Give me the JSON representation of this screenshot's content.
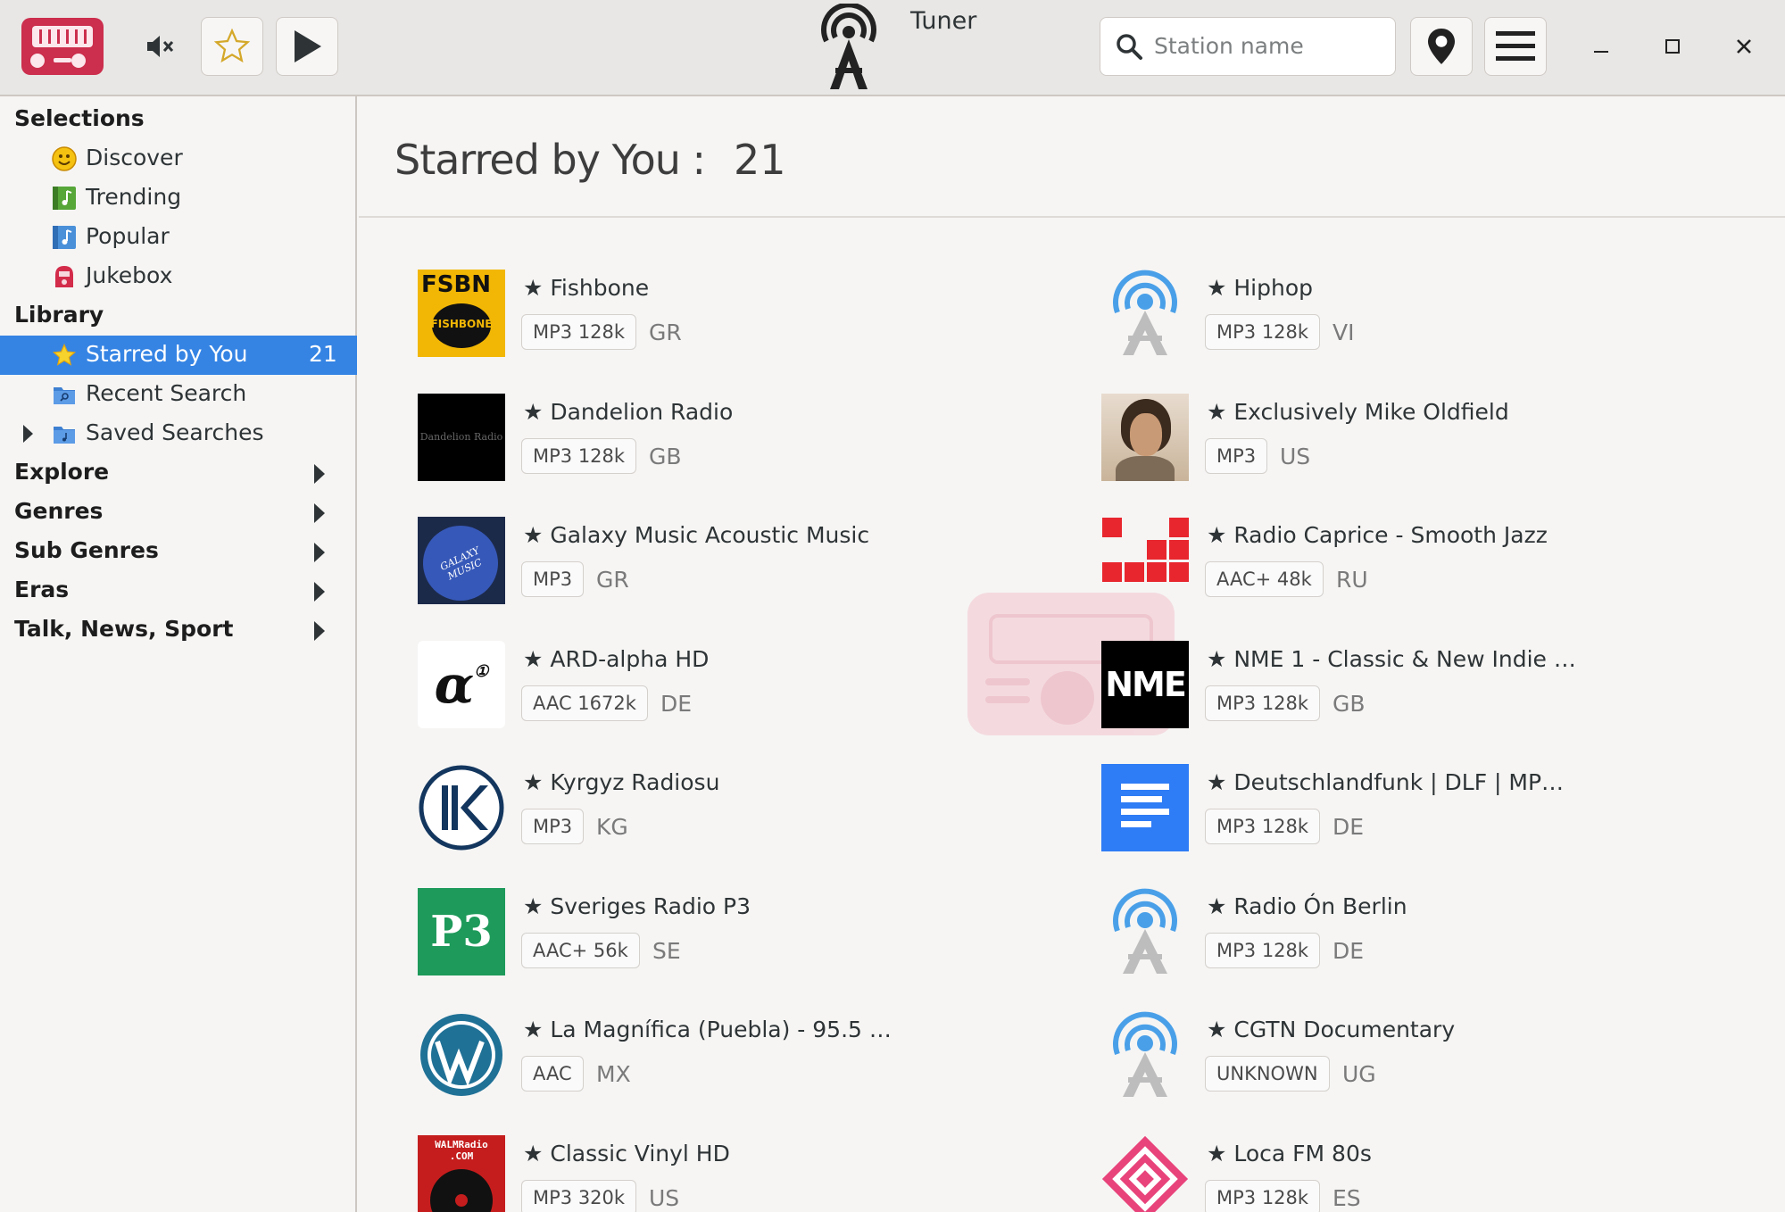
{
  "header": {
    "title": "Tuner",
    "search_placeholder": "Station name"
  },
  "sidebar": {
    "selections_label": "Selections",
    "library_label": "Library",
    "selections": [
      {
        "label": "Discover",
        "icon": "smiley-icon"
      },
      {
        "label": "Trending",
        "icon": "music-green-icon"
      },
      {
        "label": "Popular",
        "icon": "music-blue-icon"
      },
      {
        "label": "Jukebox",
        "icon": "jukebox-icon"
      }
    ],
    "library": [
      {
        "label": "Starred by You",
        "count": "21",
        "icon": "star-icon"
      },
      {
        "label": "Recent Search",
        "icon": "folder-search-icon"
      },
      {
        "label": "Saved Searches",
        "icon": "folder-music-icon"
      }
    ],
    "categories": [
      "Explore",
      "Genres",
      "Sub Genres",
      "Eras",
      "Talk, News, Sport"
    ]
  },
  "main": {
    "heading": "Starred by You :",
    "count": "21"
  },
  "stations": [
    {
      "name": "★ Fishbone",
      "tag": "MP3 128k",
      "country": "GR",
      "logo": "fishbone"
    },
    {
      "name": "★ Hiphop",
      "tag": "MP3 128k",
      "country": "VI",
      "logo": "default"
    },
    {
      "name": "★ Dandelion Radio",
      "tag": "MP3 128k",
      "country": "GB",
      "logo": "dandelion"
    },
    {
      "name": "★ Exclusively Mike Oldfield",
      "tag": "MP3",
      "country": "US",
      "logo": "photo"
    },
    {
      "name": "★ Galaxy Music Acoustic Music",
      "tag": "MP3",
      "country": "GR",
      "logo": "galaxy"
    },
    {
      "name": "★ Radio Caprice - Smooth Jazz",
      "tag": "AAC+ 48k",
      "country": "RU",
      "logo": "caprice"
    },
    {
      "name": "★ ARD-alpha HD",
      "tag": "AAC 1672k",
      "country": "DE",
      "logo": "alpha"
    },
    {
      "name": "★ NME 1 - Classic & New Indie …",
      "tag": "MP3 128k",
      "country": "GB",
      "logo": "nme"
    },
    {
      "name": "★ Kyrgyz Radiosu",
      "tag": "MP3",
      "country": "KG",
      "logo": "kyrgyz"
    },
    {
      "name": "★ Deutschlandfunk | DLF | MP…",
      "tag": "MP3 128k",
      "country": "DE",
      "logo": "dlf"
    },
    {
      "name": "★ Sveriges Radio P3",
      "tag": "AAC+ 56k",
      "country": "SE",
      "logo": "p3"
    },
    {
      "name": "★ Radio Ón Berlin",
      "tag": "MP3 128k",
      "country": "DE",
      "logo": "default"
    },
    {
      "name": "★ La Magnífica (Puebla) - 95.5 …",
      "tag": "AAC",
      "country": "MX",
      "logo": "wordpress"
    },
    {
      "name": "★ CGTN Documentary",
      "tag": "UNKNOWN",
      "country": "UG",
      "logo": "default"
    },
    {
      "name": "★ Classic Vinyl HD",
      "tag": "MP3 320k",
      "country": "US",
      "logo": "vinyl"
    },
    {
      "name": "★ Loca FM 80s",
      "tag": "MP3 128k",
      "country": "ES",
      "logo": "loca"
    }
  ],
  "logo_text": {
    "fishbone": "FSBN",
    "fishbone_sub": "FISHBONE",
    "dandelion": "Dandelion Radio",
    "galaxy": "GALAXY MUSIC",
    "alpha": "α",
    "nme": "NME",
    "p3": "P3",
    "vinyl": "WALMRadio .COM"
  },
  "colors": {
    "accent": "#3584e4",
    "app_icon": "#cc2e4d",
    "caprice": "#e8262e",
    "dlf": "#2e7cf6",
    "p3": "#1e9a5a",
    "wordpress": "#207196"
  }
}
